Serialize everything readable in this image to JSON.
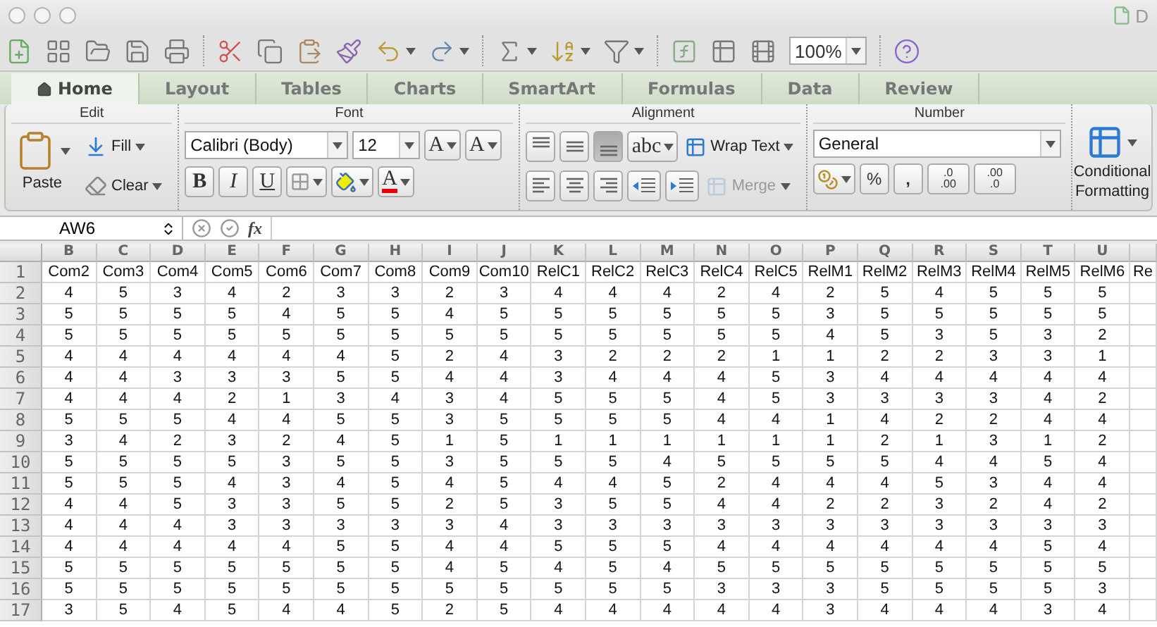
{
  "window": {
    "title": "D"
  },
  "toolbar": {
    "zoom": "100%"
  },
  "tabs": [
    {
      "label": "Home",
      "selected": true
    },
    {
      "label": "Layout",
      "selected": false
    },
    {
      "label": "Tables",
      "selected": false
    },
    {
      "label": "Charts",
      "selected": false
    },
    {
      "label": "SmartArt",
      "selected": false
    },
    {
      "label": "Formulas",
      "selected": false
    },
    {
      "label": "Data",
      "selected": false
    },
    {
      "label": "Review",
      "selected": false
    }
  ],
  "ribbon": {
    "edit": {
      "title": "Edit",
      "paste": "Paste",
      "fill": "Fill",
      "clear": "Clear"
    },
    "font": {
      "title": "Font",
      "family": "Calibri (Body)",
      "size": "12",
      "grow": "A",
      "shrink": "A",
      "bold": "B",
      "italic": "I",
      "underline": "U",
      "font_color_letter": "A"
    },
    "alignment": {
      "title": "Alignment",
      "vertical": [
        {
          "pressed": false
        },
        {
          "pressed": false
        },
        {
          "pressed": true
        }
      ],
      "orientation": "abc",
      "wrap": "Wrap Text",
      "merge": {
        "label": "Merge",
        "disabled": true
      }
    },
    "number": {
      "title": "Number",
      "format": "General",
      "percent": "%",
      "comma": ",",
      "decrease_decimal": [
        ".0",
        ".00"
      ],
      "increase_decimal": [
        ".00",
        ".0"
      ]
    },
    "conditional_formatting": [
      "Conditional",
      "Formatting"
    ]
  },
  "formula_bar": {
    "name_box": "AW6",
    "fx": "fx"
  },
  "sheet": {
    "columns": [
      "B",
      "C",
      "D",
      "E",
      "F",
      "G",
      "H",
      "I",
      "J",
      "K",
      "L",
      "M",
      "N",
      "O",
      "P",
      "Q",
      "R",
      "S",
      "T",
      "U"
    ],
    "rows": [
      {
        "number": "1",
        "cells": [
          "Com2",
          "Com3",
          "Com4",
          "Com5",
          "Com6",
          "Com7",
          "Com8",
          "Com9",
          "Com10",
          "RelC1",
          "RelC2",
          "RelC3",
          "RelC4",
          "RelC5",
          "RelM1",
          "RelM2",
          "RelM3",
          "RelM4",
          "RelM5",
          "RelM6",
          "Re"
        ]
      },
      {
        "number": "2",
        "cells": [
          "4",
          "5",
          "3",
          "4",
          "2",
          "3",
          "3",
          "2",
          "3",
          "4",
          "4",
          "4",
          "2",
          "4",
          "2",
          "5",
          "4",
          "5",
          "5",
          "5"
        ]
      },
      {
        "number": "3",
        "cells": [
          "5",
          "5",
          "5",
          "5",
          "4",
          "5",
          "5",
          "4",
          "5",
          "5",
          "5",
          "5",
          "5",
          "5",
          "3",
          "5",
          "5",
          "5",
          "5",
          "5"
        ]
      },
      {
        "number": "4",
        "cells": [
          "5",
          "5",
          "5",
          "5",
          "5",
          "5",
          "5",
          "5",
          "5",
          "5",
          "5",
          "5",
          "5",
          "5",
          "4",
          "5",
          "3",
          "5",
          "3",
          "2"
        ]
      },
      {
        "number": "5",
        "cells": [
          "4",
          "4",
          "4",
          "4",
          "4",
          "4",
          "5",
          "2",
          "4",
          "3",
          "2",
          "2",
          "2",
          "1",
          "1",
          "2",
          "2",
          "3",
          "3",
          "1"
        ]
      },
      {
        "number": "6",
        "cells": [
          "4",
          "4",
          "3",
          "3",
          "3",
          "5",
          "5",
          "4",
          "4",
          "3",
          "4",
          "4",
          "4",
          "5",
          "3",
          "4",
          "4",
          "4",
          "4",
          "4"
        ]
      },
      {
        "number": "7",
        "cells": [
          "4",
          "4",
          "4",
          "2",
          "1",
          "3",
          "4",
          "3",
          "4",
          "5",
          "5",
          "5",
          "4",
          "5",
          "3",
          "3",
          "3",
          "3",
          "4",
          "2"
        ]
      },
      {
        "number": "8",
        "cells": [
          "5",
          "5",
          "5",
          "4",
          "4",
          "5",
          "5",
          "3",
          "5",
          "5",
          "5",
          "5",
          "4",
          "4",
          "1",
          "4",
          "2",
          "2",
          "4",
          "4"
        ]
      },
      {
        "number": "9",
        "cells": [
          "3",
          "4",
          "2",
          "3",
          "2",
          "4",
          "5",
          "1",
          "5",
          "1",
          "1",
          "1",
          "1",
          "1",
          "1",
          "2",
          "1",
          "3",
          "1",
          "2"
        ]
      },
      {
        "number": "10",
        "cells": [
          "5",
          "5",
          "5",
          "5",
          "3",
          "5",
          "5",
          "3",
          "5",
          "5",
          "5",
          "4",
          "5",
          "5",
          "5",
          "5",
          "4",
          "4",
          "5",
          "4"
        ]
      },
      {
        "number": "11",
        "cells": [
          "5",
          "5",
          "5",
          "4",
          "3",
          "4",
          "5",
          "4",
          "5",
          "4",
          "4",
          "5",
          "2",
          "4",
          "4",
          "4",
          "5",
          "3",
          "4",
          "4"
        ]
      },
      {
        "number": "12",
        "cells": [
          "4",
          "4",
          "5",
          "3",
          "3",
          "5",
          "5",
          "2",
          "5",
          "3",
          "5",
          "5",
          "4",
          "4",
          "2",
          "2",
          "3",
          "2",
          "4",
          "2"
        ]
      },
      {
        "number": "13",
        "cells": [
          "4",
          "4",
          "4",
          "3",
          "3",
          "3",
          "3",
          "3",
          "4",
          "3",
          "3",
          "3",
          "3",
          "3",
          "3",
          "3",
          "3",
          "3",
          "3",
          "3"
        ]
      },
      {
        "number": "14",
        "cells": [
          "4",
          "4",
          "4",
          "4",
          "4",
          "5",
          "5",
          "4",
          "4",
          "5",
          "5",
          "5",
          "4",
          "4",
          "4",
          "4",
          "4",
          "4",
          "5",
          "4"
        ]
      },
      {
        "number": "15",
        "cells": [
          "5",
          "5",
          "5",
          "5",
          "5",
          "5",
          "5",
          "4",
          "5",
          "4",
          "5",
          "4",
          "5",
          "5",
          "5",
          "5",
          "5",
          "5",
          "5",
          "5"
        ]
      },
      {
        "number": "16",
        "cells": [
          "5",
          "5",
          "5",
          "5",
          "5",
          "5",
          "5",
          "5",
          "5",
          "5",
          "5",
          "5",
          "3",
          "3",
          "3",
          "5",
          "5",
          "5",
          "5",
          "3"
        ]
      },
      {
        "number": "17",
        "cells": [
          "3",
          "5",
          "4",
          "5",
          "4",
          "4",
          "5",
          "2",
          "5",
          "4",
          "4",
          "4",
          "4",
          "4",
          "3",
          "4",
          "4",
          "4",
          "3",
          "4"
        ]
      }
    ]
  }
}
